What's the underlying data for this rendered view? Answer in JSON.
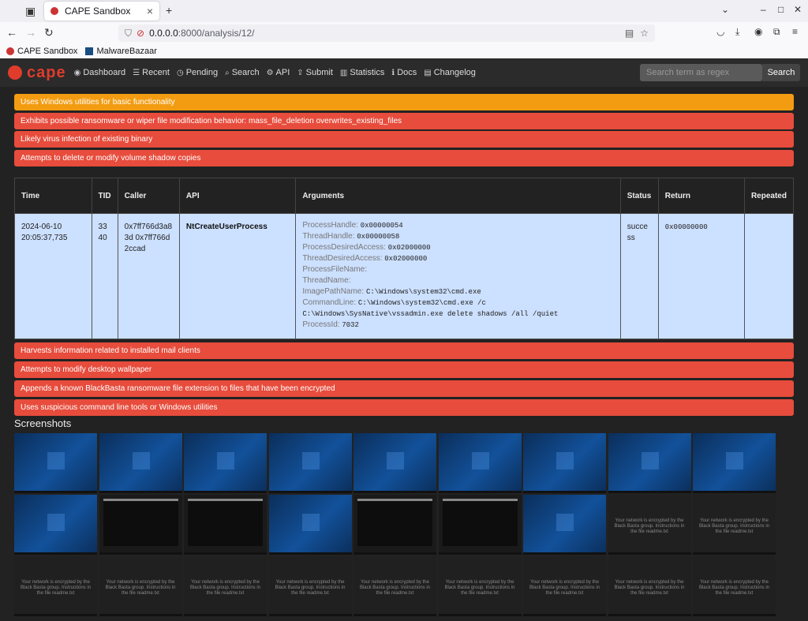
{
  "browser": {
    "tab_title": "CAPE Sandbox",
    "url_host": "0.0.0.0",
    "url_path": ":8000/analysis/12/",
    "bookmarks": [
      "CAPE Sandbox",
      "MalwareBazaar"
    ]
  },
  "nav": {
    "logo": "cape",
    "items": [
      {
        "icon": "dashboard-icon",
        "glyph": "◉",
        "label": "Dashboard"
      },
      {
        "icon": "list-icon",
        "glyph": "☰",
        "label": "Recent"
      },
      {
        "icon": "clock-icon",
        "glyph": "◷",
        "label": "Pending"
      },
      {
        "icon": "search-icon",
        "glyph": "⌕",
        "label": "Search"
      },
      {
        "icon": "api-icon",
        "glyph": "⚙",
        "label": "API"
      },
      {
        "icon": "upload-icon",
        "glyph": "⇪",
        "label": "Submit"
      },
      {
        "icon": "chart-icon",
        "glyph": "▥",
        "label": "Statistics"
      },
      {
        "icon": "info-icon",
        "glyph": "ℹ",
        "label": "Docs"
      },
      {
        "icon": "changelog-icon",
        "glyph": "▤",
        "label": "Changelog"
      }
    ],
    "search_placeholder": "Search term as regex",
    "search_button": "Search"
  },
  "signatures_top": [
    {
      "text": "Uses Windows utilities for basic functionality",
      "severity": "orange"
    },
    {
      "text": "Exhibits possible ransomware or wiper file modification behavior: mass_file_deletion overwrites_existing_files",
      "severity": "red"
    },
    {
      "text": "Likely virus infection of existing binary",
      "severity": "red"
    },
    {
      "text": "Attempts to delete or modify volume shadow copies",
      "severity": "red"
    }
  ],
  "table": {
    "headers": [
      "Time",
      "TID",
      "Caller",
      "API",
      "Arguments",
      "Status",
      "Return",
      "Repeated"
    ],
    "row": {
      "time": "2024-06-10 20:05:37,735",
      "tid": "3340",
      "caller": "0x7ff766d3a83d 0x7ff766d2ccad",
      "api": "NtCreateUserProcess",
      "arguments": [
        {
          "k": "ProcessHandle:",
          "v": "0x00000054"
        },
        {
          "k": "ThreadHandle:",
          "v": "0x00000058"
        },
        {
          "k": "ProcessDesiredAccess:",
          "v": "0x02000000"
        },
        {
          "k": "ThreadDesiredAccess:",
          "v": "0x02000000"
        },
        {
          "k": "ProcessFileName:",
          "v": ""
        },
        {
          "k": "ThreadName:",
          "v": ""
        },
        {
          "k": "ImagePathName:",
          "v": "C:\\Windows\\system32\\cmd.exe"
        },
        {
          "k": "CommandLine:",
          "v": "C:\\Windows\\system32\\cmd.exe /c C:\\Windows\\SysNative\\vssadmin.exe delete shadows /all /quiet"
        },
        {
          "k": "ProcessId:",
          "v": "7032"
        }
      ],
      "status": "success",
      "return": "0x00000000",
      "repeated": ""
    }
  },
  "signatures_bottom": [
    {
      "text": "Harvests information related to installed mail clients",
      "severity": "red"
    },
    {
      "text": "Attempts to modify desktop wallpaper",
      "severity": "red"
    },
    {
      "text": "Appends a known BlackBasta ransomware file extension to files that have been encrypted",
      "severity": "red"
    },
    {
      "text": "Uses suspicious command line tools or Windows utilities",
      "severity": "red"
    }
  ],
  "screenshots_title": "Screenshots",
  "screenshot_message": "Your network is encrypted by the Black Basta group. Instructions in the file readme.txt",
  "screenshots": [
    "desktop",
    "desktop",
    "desktop",
    "desktop",
    "desktop",
    "desktop",
    "desktop",
    "desktop",
    "desktop",
    "desktop",
    "terminal",
    "terminal",
    "desktop",
    "terminal",
    "terminal",
    "desktop",
    "ransom",
    "ransom",
    "ransom",
    "ransom",
    "ransom",
    "ransom",
    "ransom",
    "ransom",
    "ransom",
    "ransom",
    "ransom"
  ]
}
